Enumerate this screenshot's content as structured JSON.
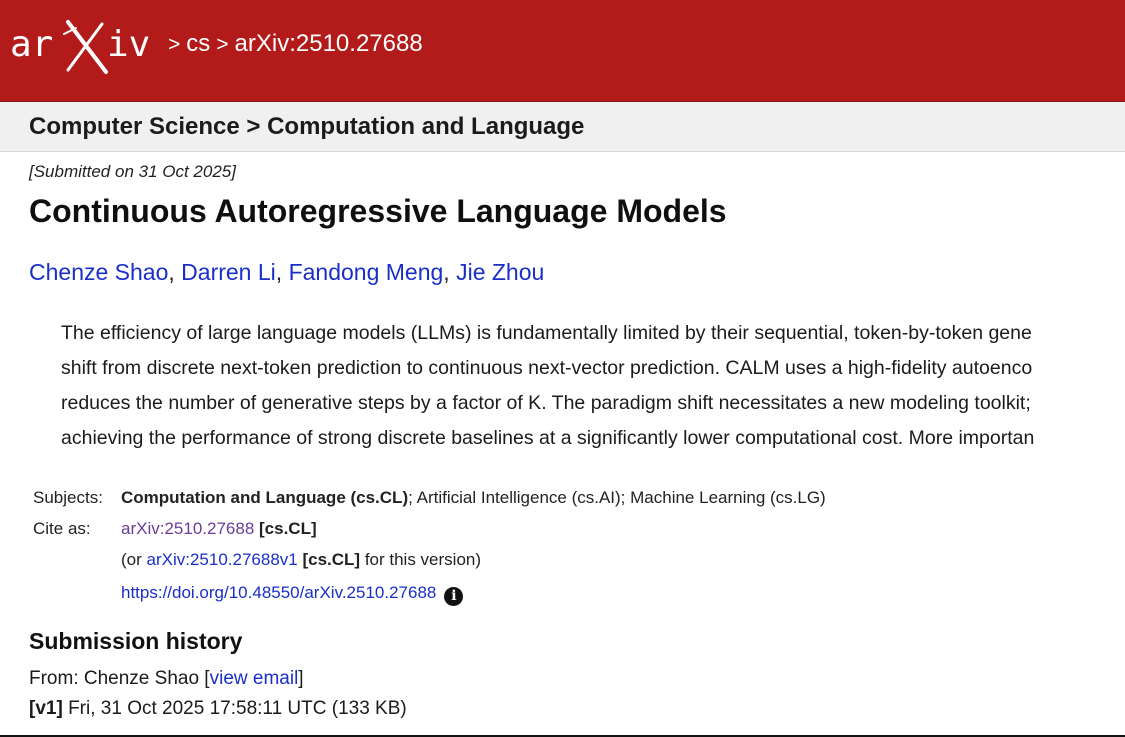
{
  "header": {
    "logo_text": "arXiv",
    "breadcrumb": [
      {
        "label": "cs"
      },
      {
        "label": "arXiv:2510.27688"
      }
    ],
    "separator": ">",
    "colors": {
      "brand": "#b31b1b"
    }
  },
  "subheader": {
    "text": "Computer Science > Computation and Language"
  },
  "paper": {
    "submitted": "[Submitted on 31 Oct 2025]",
    "title": "Continuous Autoregressive Language Models",
    "authors": [
      "Chenze Shao",
      "Darren Li",
      "Fandong Meng",
      "Jie Zhou"
    ],
    "abstract_lines": [
      "The efficiency of large language models (LLMs) is fundamentally limited by their sequential, token-by-token gene",
      "shift from discrete next-token prediction to continuous next-vector prediction. CALM uses a high-fidelity autoenco",
      "reduces the number of generative steps by a factor of K. The paradigm shift necessitates a new modeling toolkit;",
      "achieving the performance of strong discrete baselines at a significantly lower computational cost. More importan"
    ]
  },
  "meta": {
    "subjects_label": "Subjects:",
    "subjects_primary": "Computation and Language (cs.CL)",
    "subjects_rest": "; Artificial Intelligence (cs.AI); Machine Learning (cs.LG)",
    "cite_label": "Cite as:",
    "cite_id": "arXiv:2510.27688",
    "cite_cat": "[cs.CL]",
    "version_prefix": "(or ",
    "version_id": "arXiv:2510.27688v1",
    "version_cat": "[cs.CL]",
    "version_suffix": " for this version)",
    "doi": "https://doi.org/10.48550/arXiv.2510.27688",
    "info_icon": "i"
  },
  "history": {
    "heading": "Submission history",
    "from_prefix": "From: Chenze Shao [",
    "view_email": "view email",
    "from_suffix": "]",
    "version_tag": "[v1]",
    "version_text": " Fri, 31 Oct 2025 17:58:11 UTC (133 KB)"
  }
}
